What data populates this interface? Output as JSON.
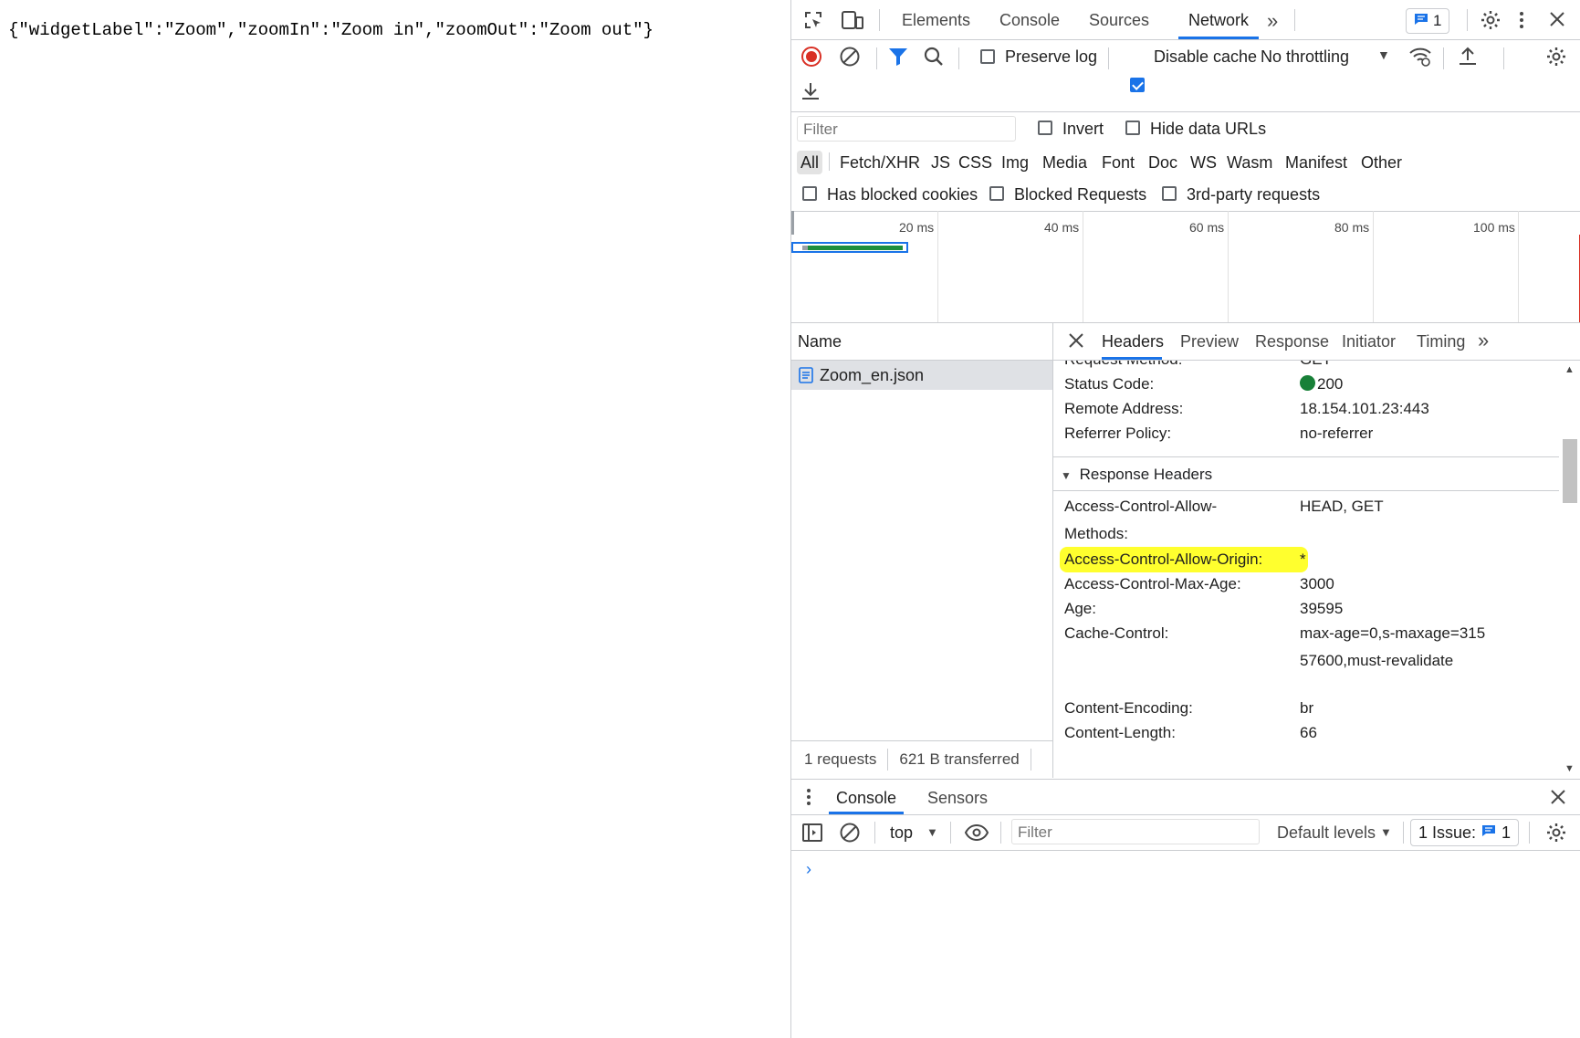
{
  "page": {
    "json_text": "{\"widgetLabel\":\"Zoom\",\"zoomIn\":\"Zoom in\",\"zoomOut\":\"Zoom out\"}"
  },
  "devtools": {
    "tabs": [
      "Elements",
      "Console",
      "Sources",
      "Network"
    ],
    "active_tab": "Network",
    "more_tabs_icon": "chevron-double-right-icon",
    "issues_count": "1"
  },
  "network_toolbar": {
    "preserve_log": "Preserve log",
    "preserve_log_checked": false,
    "disable_cache": "Disable cache",
    "disable_cache_checked": true,
    "throttling": "No throttling"
  },
  "filter": {
    "placeholder": "Filter",
    "invert": "Invert",
    "hide_data_urls": "Hide data URLs",
    "types": [
      "All",
      "Fetch/XHR",
      "JS",
      "CSS",
      "Img",
      "Media",
      "Font",
      "Doc",
      "WS",
      "Wasm",
      "Manifest",
      "Other"
    ],
    "active_type": "All",
    "has_blocked_cookies": "Has blocked cookies",
    "blocked_requests": "Blocked Requests",
    "third_party": "3rd-party requests"
  },
  "timeline": {
    "ticks": [
      "20 ms",
      "40 ms",
      "60 ms",
      "80 ms",
      "100 ms"
    ]
  },
  "requests": {
    "name_header": "Name",
    "items": [
      {
        "name": "Zoom_en.json"
      }
    ],
    "summary_requests": "1 requests",
    "summary_transferred": "621 B transferred"
  },
  "details": {
    "tabs": [
      "Headers",
      "Preview",
      "Response",
      "Initiator",
      "Timing"
    ],
    "active_tab": "Headers",
    "general": [
      {
        "key": "Request Method:",
        "value": "GET"
      },
      {
        "key": "Status Code:",
        "value": "200"
      },
      {
        "key": "Remote Address:",
        "value": "18.154.101.23:443"
      },
      {
        "key": "Referrer Policy:",
        "value": "no-referrer"
      }
    ],
    "response_headers_title": "Response Headers",
    "response_headers": [
      {
        "key": "Access-Control-Allow-Methods:",
        "value": "HEAD, GET"
      },
      {
        "key": "Access-Control-Allow-Origin:",
        "value": "*"
      },
      {
        "key": "Access-Control-Max-Age:",
        "value": "3000"
      },
      {
        "key": "Age:",
        "value": "39595"
      },
      {
        "key": "Cache-Control:",
        "value": "max-age=0,s-maxage=31557600,must-revalidate"
      },
      {
        "key": "Content-Encoding:",
        "value": "br"
      },
      {
        "key": "Content-Length:",
        "value": "66"
      }
    ],
    "highlight_color": "#ffff2e",
    "status_color": "#188038"
  },
  "drawer": {
    "tabs": [
      "Console",
      "Sensors"
    ],
    "active_tab": "Console",
    "context": "top",
    "filter_placeholder": "Filter",
    "levels": "Default levels",
    "issues_label": "1 Issue:",
    "issues_count": "1"
  }
}
